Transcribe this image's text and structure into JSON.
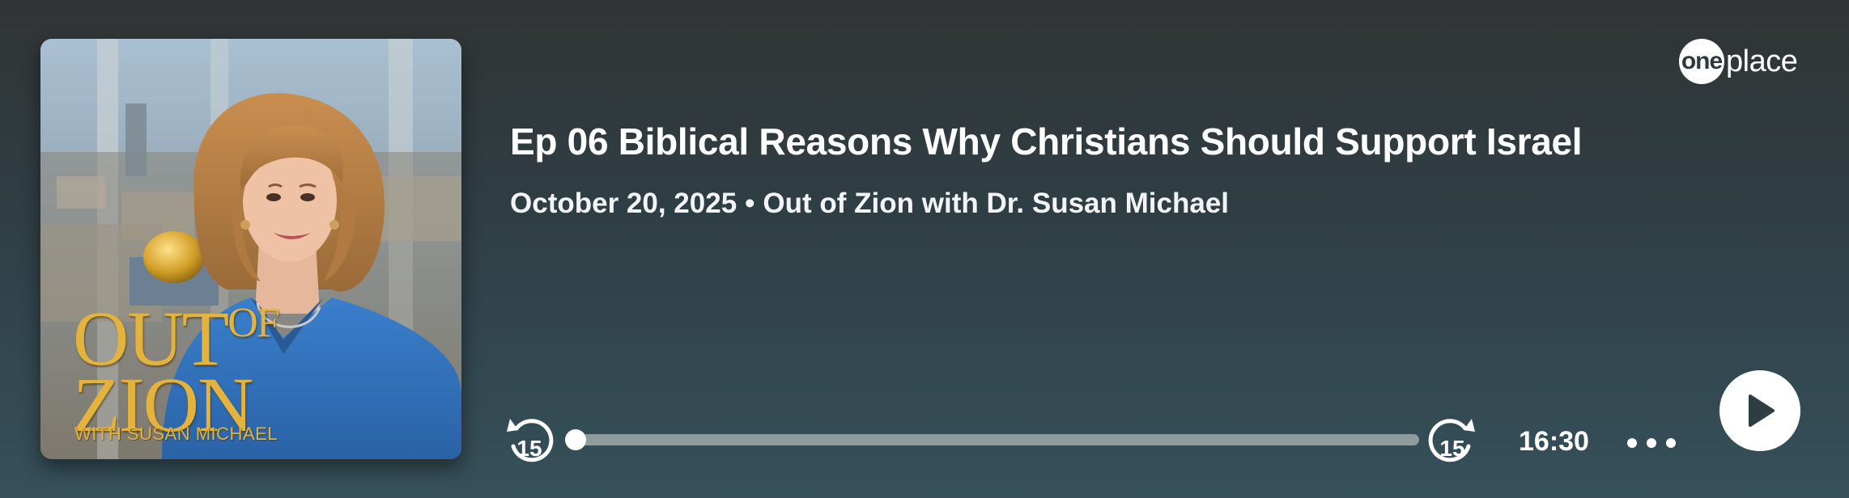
{
  "brand": {
    "logo_one": "one",
    "logo_place": "place"
  },
  "episode": {
    "title": "Ep 06 Biblical Reasons Why Christians Should Support Israel",
    "date": "October 20, 2025",
    "separator": "•",
    "show": "Out of Zion with Dr. Susan Michael"
  },
  "cover": {
    "line1": "OUT",
    "of": "OF",
    "line2": "ZION",
    "subtitle": "WITH SUSAN MICHAEL"
  },
  "controls": {
    "skip_back_seconds": "15",
    "skip_forward_seconds": "15",
    "duration": "16:30",
    "progress_fraction": 0
  },
  "colors": {
    "background_top": "#313434",
    "background_bottom": "#36505a",
    "progress_track": "#8f9c9b",
    "cover_title_gold": "#e3b33d",
    "cover_blue": "#2f6fb8"
  },
  "icons": {
    "skip_back": "rotate-ccw-15-icon",
    "skip_forward": "rotate-cw-15-icon",
    "more": "more-horizontal-icon",
    "play": "play-icon"
  }
}
